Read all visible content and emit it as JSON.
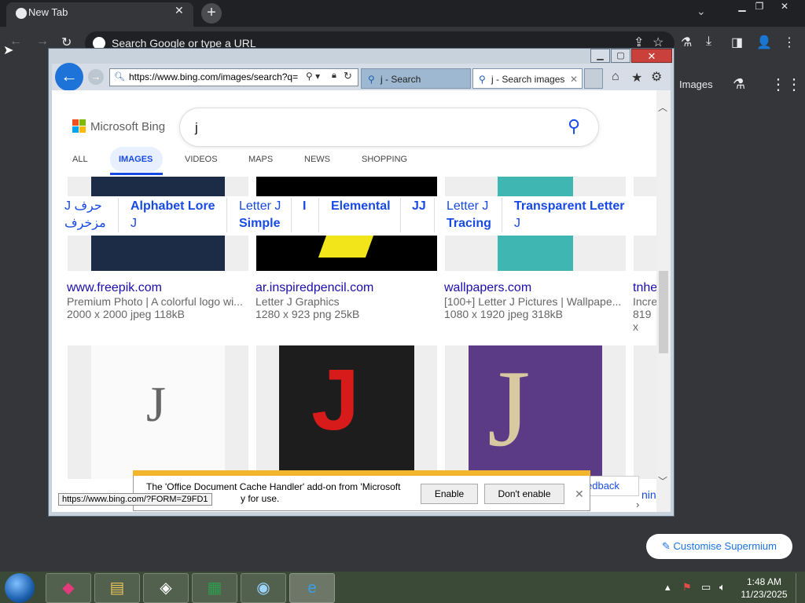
{
  "chrome": {
    "tab_title": "New Tab",
    "tab_close": "✕",
    "new_tab": "+",
    "omnibox_placeholder": "Search Google or type a URL",
    "ntp_images_link": "Images",
    "customise_label": "Customise Supermium"
  },
  "ie": {
    "address": "https://www.bing.com/images/search?q=",
    "tabs": [
      {
        "label": "j - Search"
      },
      {
        "label": "j - Search images"
      }
    ],
    "tab_close": "✕"
  },
  "bing": {
    "logo": "Microsoft Bing",
    "query": "j",
    "nav": [
      "ALL",
      "IMAGES",
      "VIDEOS",
      "MAPS",
      "NEWS",
      "SHOPPING"
    ],
    "related": [
      {
        "line1": "J حرف",
        "line2": "مزخرف"
      },
      {
        "line1": "Alphabet Lore",
        "line2": "J"
      },
      {
        "line1": "Letter J",
        "line2": "Simple"
      },
      {
        "line1": "I",
        "line2": ""
      },
      {
        "line1": "Elemental",
        "line2": ""
      },
      {
        "line1": "JJ",
        "line2": ""
      },
      {
        "line1": "Letter J",
        "line2": "Tracing"
      },
      {
        "line1": "Transparent Letter",
        "line2": "J"
      }
    ],
    "results": [
      {
        "site": "www.freepik.com",
        "desc": "Premium Photo | A colorful logo wi...",
        "dims": "2000 x 2000 jpeg 118kB"
      },
      {
        "site": "ar.inspiredpencil.com",
        "desc": "Letter J Graphics",
        "dims": "1280 x 923 png 25kB"
      },
      {
        "site": "wallpapers.com",
        "desc": "[100+] Letter J Pictures | Wallpape...",
        "dims": "1080 x 1920 jpeg 318kB"
      },
      {
        "site": "tnhe",
        "desc": "Incre",
        "dims": "819 x"
      }
    ],
    "feedback": "edback",
    "partial_text": "nin"
  },
  "notification": {
    "text_line1": "The 'Office Document Cache Handler' add-on from 'Microsoft",
    "text_line2": "y for use.",
    "enable": "Enable",
    "dont_enable": "Don't enable",
    "close": "✕"
  },
  "status_url": "https://www.bing.com/?FORM=Z9FD1",
  "taskbar": {
    "time": "1:48 AM",
    "date": "11/23/2025"
  },
  "colors": {
    "bing_link": "#1a0dab",
    "bing_blue": "#174ae4",
    "notif_yellow": "#f3b52b",
    "ie_close_red": "#c9413a"
  }
}
